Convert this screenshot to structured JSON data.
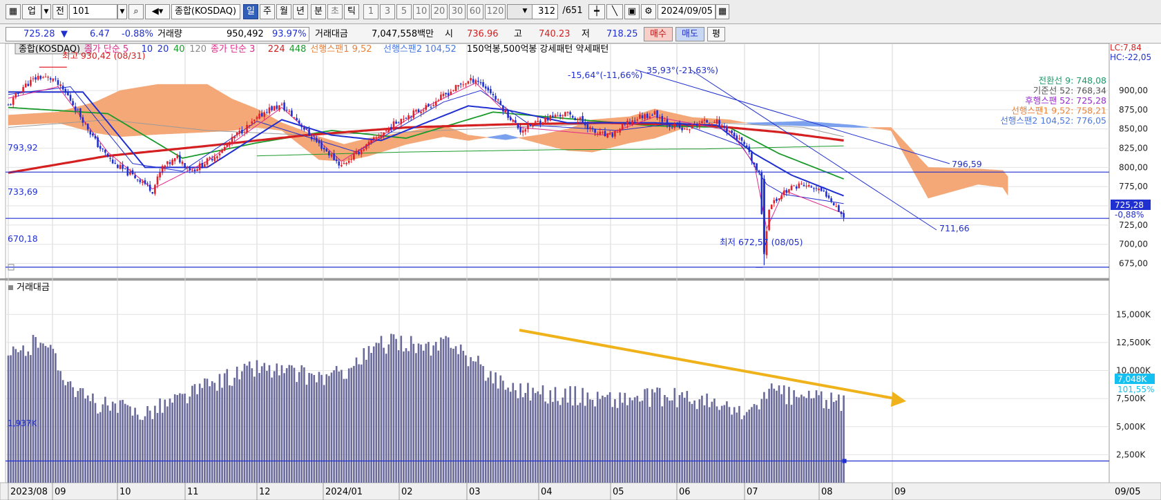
{
  "toolbar": {
    "market_label": "업",
    "prev_label": "전",
    "code": "101",
    "index_name": "종합(KOSDAQ)",
    "periods": [
      "일",
      "주",
      "월",
      "년",
      "분",
      "초",
      "틱"
    ],
    "active_period": "일",
    "intervals": [
      "1",
      "3",
      "5",
      "10",
      "20",
      "30",
      "60",
      "120"
    ],
    "count": "312",
    "total": "/651",
    "date": "2024/09/05"
  },
  "quote": {
    "price": "725.28",
    "change": "6.47",
    "change_pct": "-0.88%",
    "volume_label": "거래량",
    "volume": "950,492",
    "volume_ratio": "93.97%",
    "amount_label": "거래대금",
    "amount": "7,047,558백만",
    "open_label": "시",
    "open": "736.96",
    "high_label": "고",
    "high": "740.23",
    "low_label": "저",
    "low": "718.25",
    "buy_label": "매수",
    "sell_label": "매도",
    "extra_label": "평"
  },
  "price_panel": {
    "legend": [
      {
        "text": "종합(KOSDAQ)",
        "color": "#000000"
      },
      {
        "text": "종가 단순 5",
        "color": "#e0288c"
      },
      {
        "text": "10",
        "color": "#1f2fd0"
      },
      {
        "text": "20",
        "color": "#1f2fd0"
      },
      {
        "text": "40",
        "color": "#1a9a2a"
      },
      {
        "text": "120",
        "color": "#8a8a8a"
      },
      {
        "text": "종가 단순 3",
        "color": "#e0288c"
      },
      {
        "text": "224",
        "color": "#d42020"
      },
      {
        "text": "448",
        "color": "#1a9a2a"
      },
      {
        "text": "선행스팬1 9,52",
        "color": "#e8823a"
      },
      {
        "text": "선행스팬2 104,52",
        "color": "#4a78e0"
      },
      {
        "text": "150억봉,500억봉 강세패턴  약세패턴",
        "color": "#000000"
      }
    ],
    "lc": "LC:7,84",
    "hc": "HC:-22,05",
    "high_note": "최고 930,42 (08/31)",
    "low_note": "최저 672,57 (08/05)",
    "left_labels": [
      "793,92",
      "733,69",
      "670,18"
    ],
    "trend_notes": [
      "-15,64°(-11,66%)",
      "35,93°(-21,63%)",
      "796,59",
      "711,66"
    ],
    "indicators": [
      {
        "text": "전환선 9: 748,08",
        "color": "#1a9a6a"
      },
      {
        "text": "기준선 52: 768,34",
        "color": "#555555"
      },
      {
        "text": "후행스팬 52: 725,28",
        "color": "#9a2ad0"
      },
      {
        "text": "선행스팬1 9,52: 758,21",
        "color": "#e8823a"
      },
      {
        "text": "선행스팬2 104,52: 776,05",
        "color": "#4a78e0"
      }
    ],
    "current_price": "725,28",
    "current_pct": "-0,88%",
    "y_ticks": [
      "900,00",
      "875,00",
      "850,00",
      "825,00",
      "800,00",
      "775,00",
      "750,00",
      "725,00",
      "700,00",
      "675,00"
    ]
  },
  "volume_panel": {
    "title": "거래대금",
    "left_label": "1,937K",
    "current": "7,048K",
    "current_pct": "101,55%",
    "y_ticks": [
      "15,000K",
      "12,500K",
      "10,000K",
      "7,500K",
      "5,000K",
      "2,500K"
    ]
  },
  "x_axis": {
    "labels": [
      "2023/08",
      "09",
      "10",
      "11",
      "12",
      "2024/01",
      "02",
      "03",
      "04",
      "05",
      "06",
      "07",
      "08",
      "09"
    ],
    "right_label": "09/05"
  },
  "colors": {
    "up": "#e0202a",
    "down": "#1f2fd0",
    "volume": "#6a6a9a",
    "arrow": "#f0b21a",
    "accent": "#2f5fb8"
  },
  "chart_data": {
    "type": "candlestick",
    "price_ylim": [
      662,
      945
    ],
    "volume_ylim": [
      0,
      17600
    ],
    "current_price": 725.28,
    "highest": {
      "value": 930.42,
      "date": "08/31"
    },
    "lowest": {
      "value": 672.57,
      "date": "08/05"
    },
    "horizontal_levels": [
      793.92,
      733.69,
      670.18
    ],
    "volume_current": 7048,
    "volume_level": 1937,
    "price_anchors": [
      [
        0,
        880
      ],
      [
        6,
        905
      ],
      [
        12,
        918
      ],
      [
        18,
        915
      ],
      [
        24,
        893
      ],
      [
        30,
        862
      ],
      [
        36,
        829
      ],
      [
        42,
        806
      ],
      [
        48,
        793
      ],
      [
        54,
        782
      ],
      [
        58,
        770
      ],
      [
        62,
        800
      ],
      [
        68,
        812
      ],
      [
        74,
        796
      ],
      [
        80,
        808
      ],
      [
        86,
        822
      ],
      [
        92,
        843
      ],
      [
        98,
        857
      ],
      [
        104,
        875
      ],
      [
        110,
        880
      ],
      [
        116,
        862
      ],
      [
        122,
        839
      ],
      [
        128,
        821
      ],
      [
        134,
        802
      ],
      [
        140,
        818
      ],
      [
        146,
        833
      ],
      [
        152,
        848
      ],
      [
        158,
        864
      ],
      [
        164,
        872
      ],
      [
        170,
        882
      ],
      [
        176,
        895
      ],
      [
        182,
        908
      ],
      [
        188,
        915
      ],
      [
        194,
        898
      ],
      [
        200,
        872
      ],
      [
        206,
        848
      ],
      [
        212,
        858
      ],
      [
        218,
        865
      ],
      [
        224,
        870
      ],
      [
        230,
        862
      ],
      [
        236,
        845
      ],
      [
        242,
        840
      ],
      [
        248,
        855
      ],
      [
        254,
        866
      ],
      [
        260,
        870
      ],
      [
        266,
        856
      ],
      [
        272,
        848
      ],
      [
        278,
        858
      ],
      [
        284,
        861
      ],
      [
        290,
        847
      ],
      [
        296,
        829
      ],
      [
        302,
        790
      ],
      [
        304,
        690
      ],
      [
        306,
        748
      ],
      [
        312,
        768
      ],
      [
        318,
        778
      ],
      [
        324,
        773
      ],
      [
        330,
        763
      ],
      [
        336,
        736
      ]
    ],
    "volume_anchors": [
      [
        0,
        11200
      ],
      [
        8,
        11900
      ],
      [
        14,
        13200
      ],
      [
        20,
        10400
      ],
      [
        30,
        7600
      ],
      [
        40,
        6700
      ],
      [
        55,
        6300
      ],
      [
        70,
        7600
      ],
      [
        85,
        9100
      ],
      [
        100,
        10300
      ],
      [
        115,
        9700
      ],
      [
        130,
        9300
      ],
      [
        140,
        10700
      ],
      [
        150,
        12300
      ],
      [
        160,
        12600
      ],
      [
        170,
        11600
      ],
      [
        178,
        12900
      ],
      [
        185,
        11100
      ],
      [
        200,
        8700
      ],
      [
        215,
        7900
      ],
      [
        230,
        7700
      ],
      [
        245,
        7400
      ],
      [
        260,
        7600
      ],
      [
        275,
        7500
      ],
      [
        290,
        6500
      ],
      [
        300,
        6200
      ],
      [
        305,
        8300
      ],
      [
        315,
        7600
      ],
      [
        325,
        7700
      ],
      [
        333,
        7000
      ]
    ],
    "sma5_anchors": [
      [
        0,
        890
      ],
      [
        20,
        905
      ],
      [
        40,
        820
      ],
      [
        58,
        772
      ],
      [
        80,
        808
      ],
      [
        110,
        878
      ],
      [
        134,
        808
      ],
      [
        170,
        882
      ],
      [
        188,
        910
      ],
      [
        206,
        852
      ],
      [
        240,
        842
      ],
      [
        260,
        866
      ],
      [
        290,
        848
      ],
      [
        300,
        805
      ],
      [
        305,
        720
      ],
      [
        312,
        770
      ],
      [
        336,
        740
      ]
    ],
    "sma10_anchors": [
      [
        0,
        895
      ],
      [
        25,
        905
      ],
      [
        50,
        805
      ],
      [
        70,
        795
      ],
      [
        100,
        860
      ],
      [
        125,
        835
      ],
      [
        140,
        820
      ],
      [
        175,
        885
      ],
      [
        190,
        900
      ],
      [
        210,
        855
      ],
      [
        245,
        848
      ],
      [
        270,
        858
      ],
      [
        295,
        828
      ],
      [
        305,
        778
      ],
      [
        312,
        765
      ],
      [
        336,
        753
      ]
    ],
    "sma20_anchors": [
      [
        0,
        898
      ],
      [
        30,
        898
      ],
      [
        55,
        800
      ],
      [
        80,
        800
      ],
      [
        110,
        862
      ],
      [
        130,
        842
      ],
      [
        150,
        835
      ],
      [
        185,
        880
      ],
      [
        200,
        875
      ],
      [
        225,
        858
      ],
      [
        260,
        858
      ],
      [
        285,
        855
      ],
      [
        300,
        818
      ],
      [
        315,
        790
      ],
      [
        336,
        763
      ]
    ],
    "sma40_anchors": [
      [
        0,
        878
      ],
      [
        40,
        870
      ],
      [
        70,
        812
      ],
      [
        100,
        832
      ],
      [
        130,
        848
      ],
      [
        160,
        838
      ],
      [
        195,
        872
      ],
      [
        230,
        862
      ],
      [
        260,
        854
      ],
      [
        290,
        852
      ],
      [
        310,
        818
      ],
      [
        336,
        785
      ]
    ],
    "sma224_anchors": [
      [
        0,
        793
      ],
      [
        40,
        815
      ],
      [
        80,
        828
      ],
      [
        120,
        842
      ],
      [
        160,
        852
      ],
      [
        200,
        856
      ],
      [
        240,
        858
      ],
      [
        280,
        855
      ],
      [
        310,
        846
      ],
      [
        336,
        835
      ]
    ],
    "sma448_anchors": [
      [
        100,
        815
      ],
      [
        160,
        820
      ],
      [
        220,
        823
      ],
      [
        280,
        824
      ],
      [
        336,
        828
      ]
    ],
    "sma120_anchors": [
      [
        0,
        852
      ],
      [
        40,
        862
      ],
      [
        80,
        848
      ],
      [
        120,
        842
      ],
      [
        160,
        846
      ],
      [
        200,
        852
      ],
      [
        240,
        857
      ],
      [
        280,
        859
      ],
      [
        320,
        852
      ],
      [
        336,
        840
      ]
    ],
    "cloud": [
      [
        0,
        868,
        855
      ],
      [
        20,
        872,
        858
      ],
      [
        35,
        885,
        845
      ],
      [
        45,
        900,
        840
      ],
      [
        60,
        908,
        843
      ],
      [
        80,
        908,
        846
      ],
      [
        90,
        889,
        848
      ],
      [
        100,
        876,
        852
      ],
      [
        110,
        858,
        848
      ],
      [
        125,
        840,
        810
      ],
      [
        135,
        830,
        808
      ],
      [
        145,
        838,
        815
      ],
      [
        160,
        846,
        830
      ],
      [
        175,
        855,
        840
      ],
      [
        185,
        842,
        835
      ],
      [
        200,
        836,
        843
      ],
      [
        215,
        843,
        830
      ],
      [
        225,
        850,
        822
      ],
      [
        235,
        862,
        820
      ],
      [
        250,
        866,
        832
      ],
      [
        260,
        876,
        838
      ],
      [
        275,
        865,
        855
      ],
      [
        290,
        862,
        858
      ],
      [
        300,
        856,
        858
      ],
      [
        320,
        854,
        860
      ],
      [
        340,
        852,
        855
      ],
      [
        355,
        852,
        848
      ],
      [
        370,
        800,
        760
      ],
      [
        390,
        798,
        778
      ],
      [
        400,
        796,
        774
      ],
      [
        402,
        788,
        764
      ]
    ]
  }
}
